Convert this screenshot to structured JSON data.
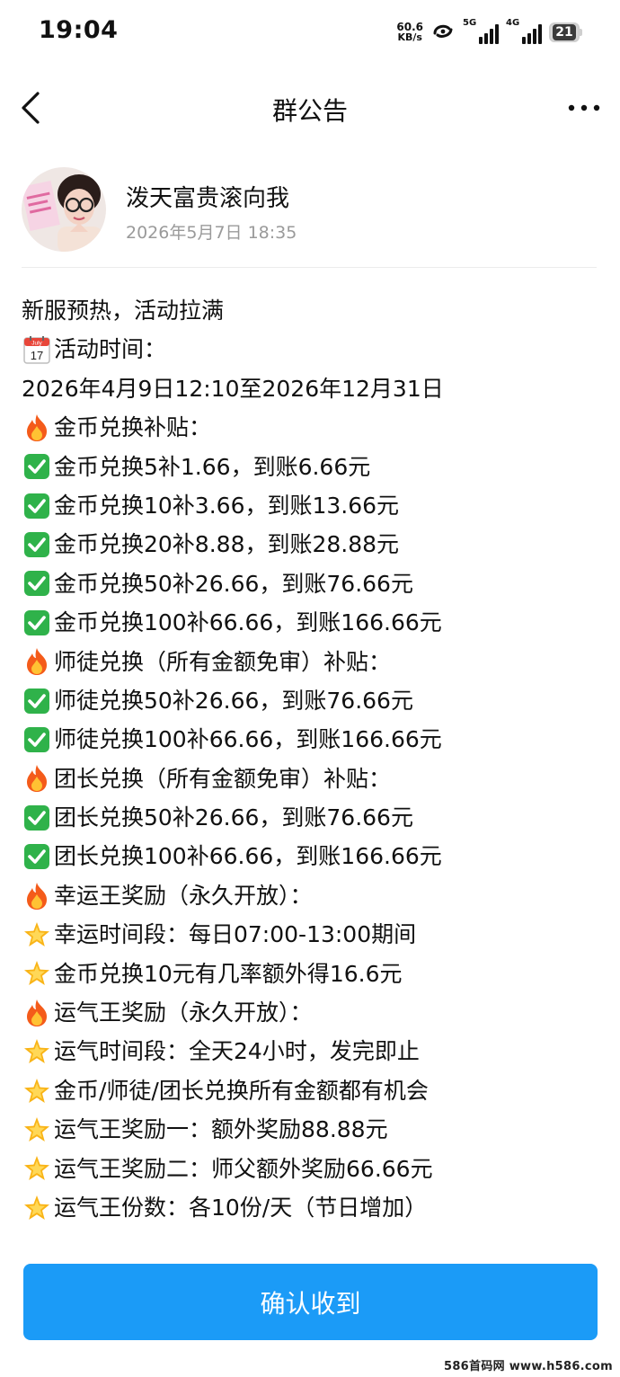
{
  "status_bar": {
    "time": "19:04",
    "net_speed_value": "60.6",
    "net_speed_unit": "KB/s",
    "sim1_tag": "5G",
    "sim2_tag": "4G",
    "battery": "21"
  },
  "nav": {
    "title": "群公告"
  },
  "author": {
    "name": "泼天富贵滚向我",
    "time": "2026年5月7日 18:35"
  },
  "announcement": {
    "lines": [
      {
        "icon": "",
        "text": "新服预热，活动拉满"
      },
      {
        "icon": "calendar",
        "text": "活动时间："
      },
      {
        "icon": "",
        "text": "2026年4月9日12:10至2026年12月31日"
      },
      {
        "icon": "fire",
        "text": "金币兑换补贴："
      },
      {
        "icon": "check",
        "text": "金币兑换5补1.66，到账6.66元"
      },
      {
        "icon": "check",
        "text": "金币兑换10补3.66，到账13.66元"
      },
      {
        "icon": "check",
        "text": "金币兑换20补8.88，到账28.88元"
      },
      {
        "icon": "check",
        "text": "金币兑换50补26.66，到账76.66元"
      },
      {
        "icon": "check",
        "text": "金币兑换100补66.66，到账166.66元"
      },
      {
        "icon": "fire",
        "text": "师徒兑换（所有金额免审）补贴："
      },
      {
        "icon": "check",
        "text": "师徒兑换50补26.66，到账76.66元"
      },
      {
        "icon": "check",
        "text": "师徒兑换100补66.66，到账166.66元"
      },
      {
        "icon": "fire",
        "text": "团长兑换（所有金额免审）补贴："
      },
      {
        "icon": "check",
        "text": "团长兑换50补26.66，到账76.66元"
      },
      {
        "icon": "check",
        "text": "团长兑换100补66.66，到账166.66元"
      },
      {
        "icon": "fire",
        "text": "幸运王奖励（永久开放）："
      },
      {
        "icon": "star",
        "text": "幸运时间段：每日07:00-13:00期间"
      },
      {
        "icon": "star",
        "text": "金币兑换10元有几率额外得16.6元"
      },
      {
        "icon": "fire",
        "text": "运气王奖励（永久开放）："
      },
      {
        "icon": "star",
        "text": "运气时间段：全天24小时，发完即止"
      },
      {
        "icon": "star",
        "text": "金币/师徒/团长兑换所有金额都有机会"
      },
      {
        "icon": "star",
        "text": "运气王奖励一：额外奖励88.88元"
      },
      {
        "icon": "star",
        "text": "运气王奖励二：师父额外奖励66.66元"
      },
      {
        "icon": "star",
        "text": "运气王份数：各10份/天（节日增加）"
      }
    ],
    "calendar_month": "July",
    "calendar_day": "17"
  },
  "confirm_button": {
    "label": "确认收到"
  },
  "watermark": "586首码网 www.h586.com",
  "colors": {
    "accent": "#1b9bf7",
    "check_green": "#2fb24a",
    "fire": "#f45b1a",
    "star": "#f9b417"
  }
}
